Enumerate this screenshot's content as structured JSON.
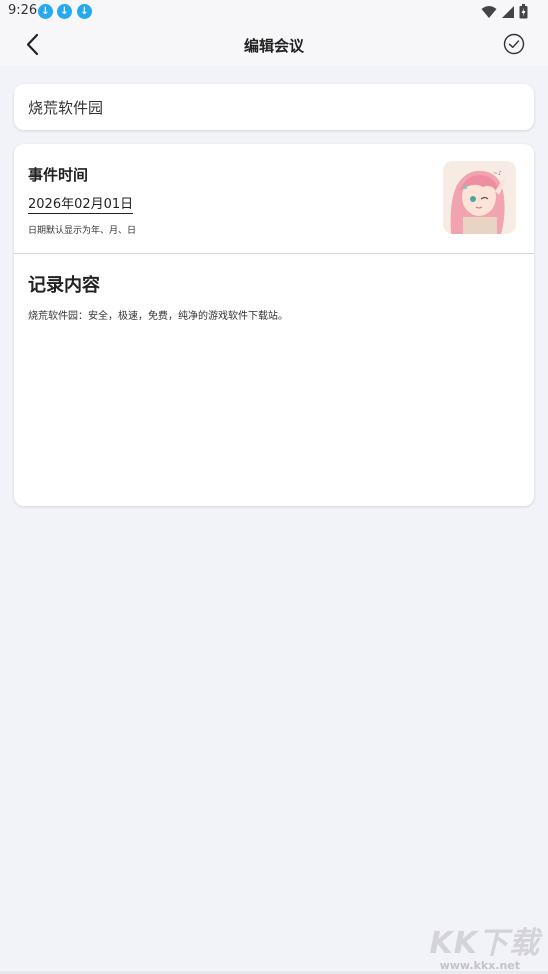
{
  "status_bar": {
    "time": "9:26",
    "icons": [
      "download-icon",
      "download-icon",
      "download-icon",
      "wifi-icon",
      "signal-icon",
      "battery-icon"
    ]
  },
  "nav": {
    "title": "编辑会议",
    "back_icon": "chevron-left-icon",
    "confirm_icon": "check-circle-icon"
  },
  "title_field": {
    "value": "烧荒软件园"
  },
  "event": {
    "label": "事件时间",
    "date": "2026年02月01日",
    "hint": "日期默认显示为年、月、日",
    "image": "anime-girl-avatar"
  },
  "record": {
    "label": "记录内容",
    "content": "烧荒软件园：安全，极速，免费，纯净的游戏软件下载站。"
  },
  "watermark": {
    "logo": "KK下载",
    "url": "www.kkx.net"
  },
  "colors": {
    "background": "#f2f3f8",
    "card": "#ffffff",
    "accent_download": "#27a9f0"
  }
}
